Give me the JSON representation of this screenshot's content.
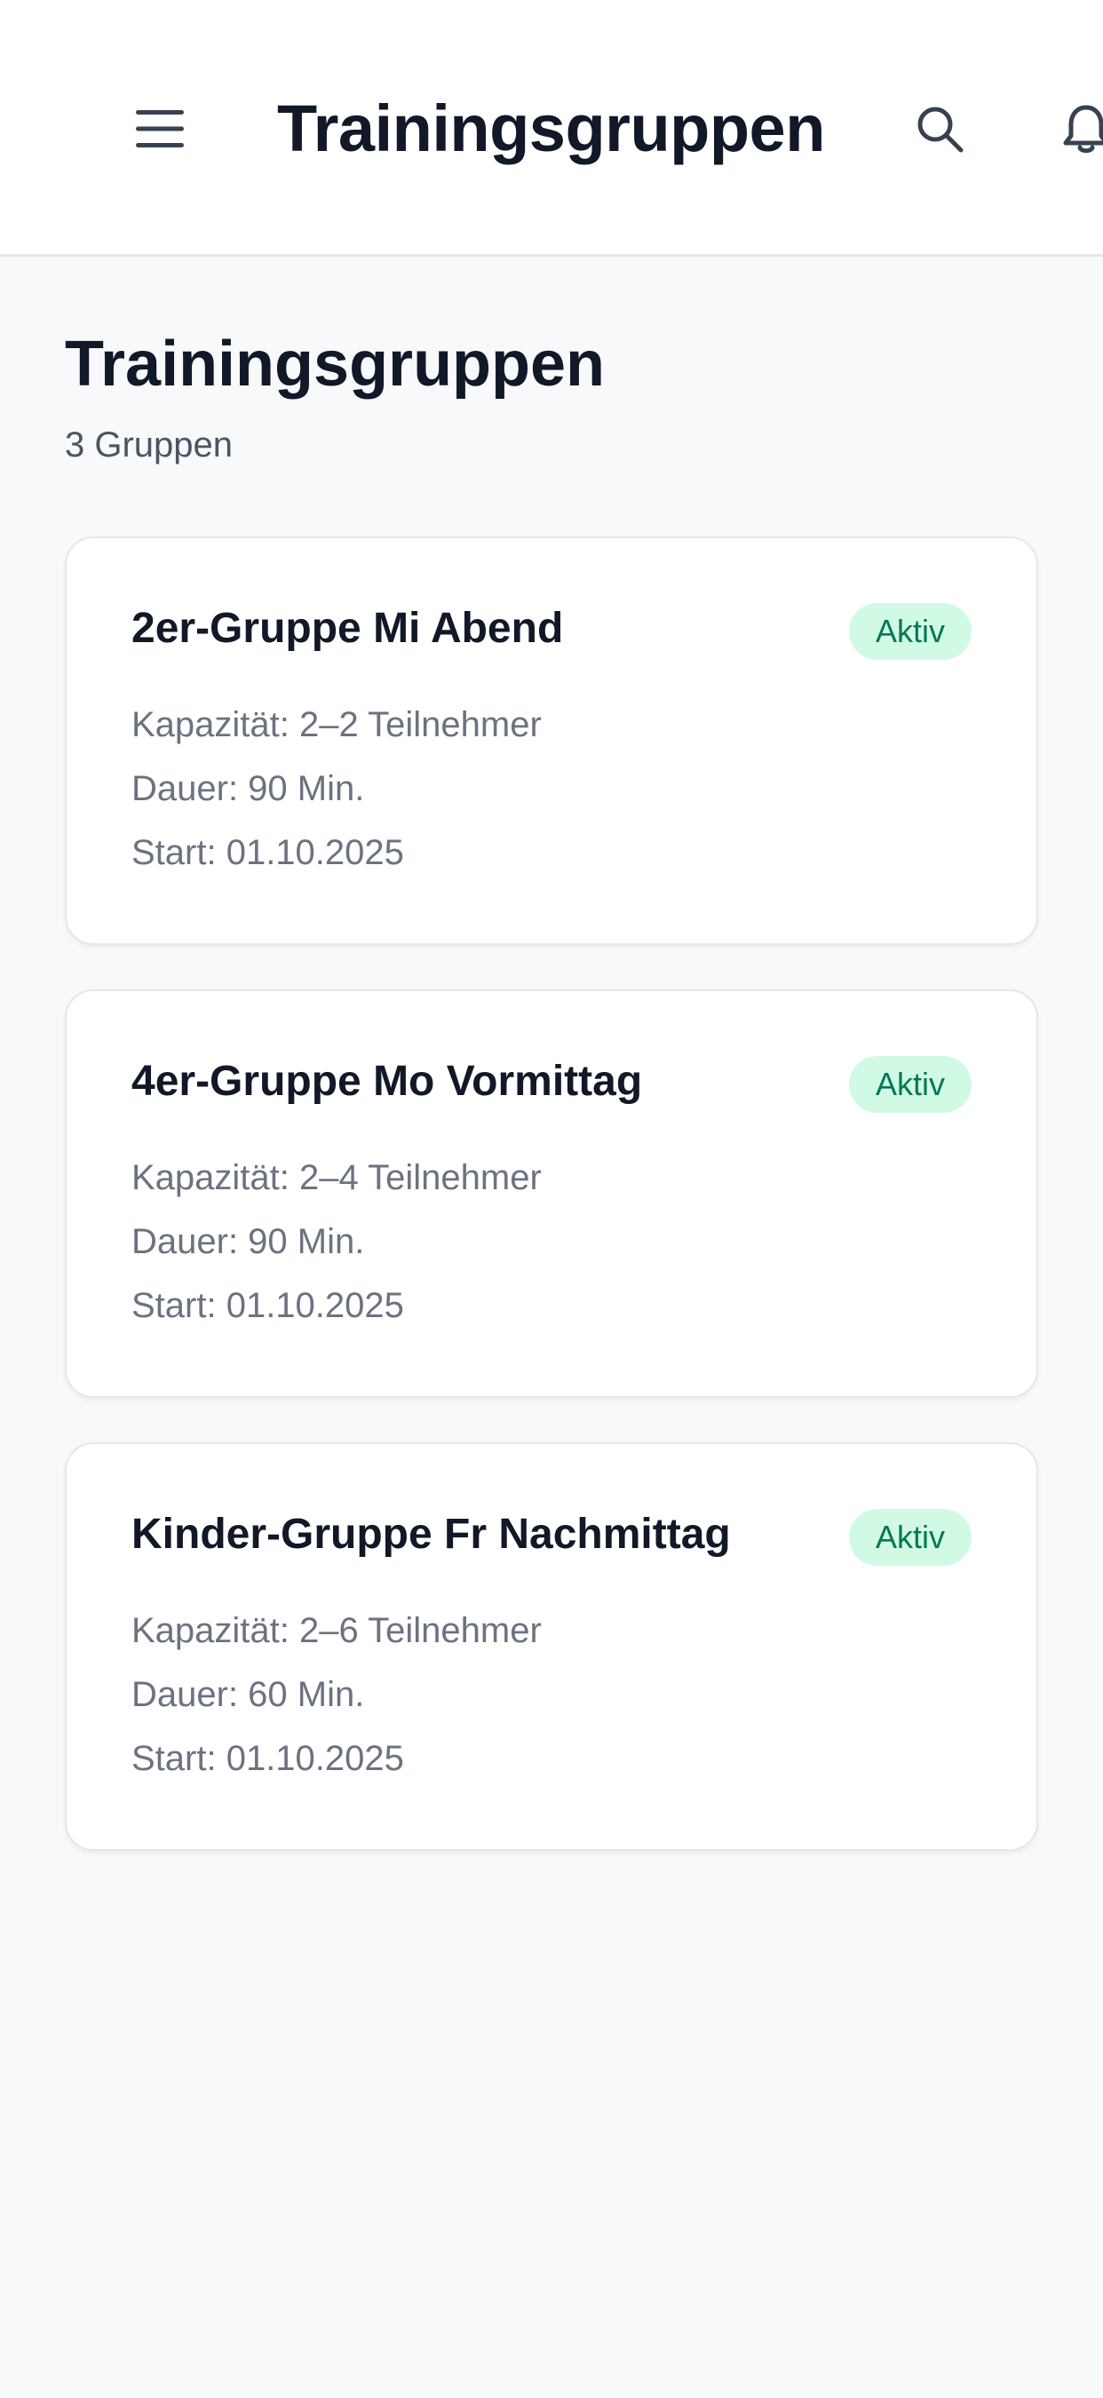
{
  "header": {
    "title": "Trainingsgruppen",
    "icons": [
      "menu-icon",
      "search-icon",
      "bell-icon"
    ]
  },
  "page": {
    "heading": "Trainingsgruppen",
    "count_label": "3 Gruppen"
  },
  "groups": [
    {
      "name": "2er-Gruppe Mi Abend",
      "status": "Aktiv",
      "capacity": "Kapazität: 2–2 Teilnehmer",
      "duration": "Dauer: 90 Min.",
      "start": "Start: 01.10.2025"
    },
    {
      "name": "4er-Gruppe Mo Vormittag",
      "status": "Aktiv",
      "capacity": "Kapazität: 2–4 Teilnehmer",
      "duration": "Dauer: 90 Min.",
      "start": "Start: 01.10.2025"
    },
    {
      "name": "Kinder-Gruppe Fr Nachmittag",
      "status": "Aktiv",
      "capacity": "Kapazität: 2–6 Teilnehmer",
      "duration": "Dauer: 60 Min.",
      "start": "Start: 01.10.2025"
    }
  ],
  "colors": {
    "badge_bg": "#d1fae5",
    "badge_text": "#047857",
    "page_bg": "#f8f9fb"
  }
}
